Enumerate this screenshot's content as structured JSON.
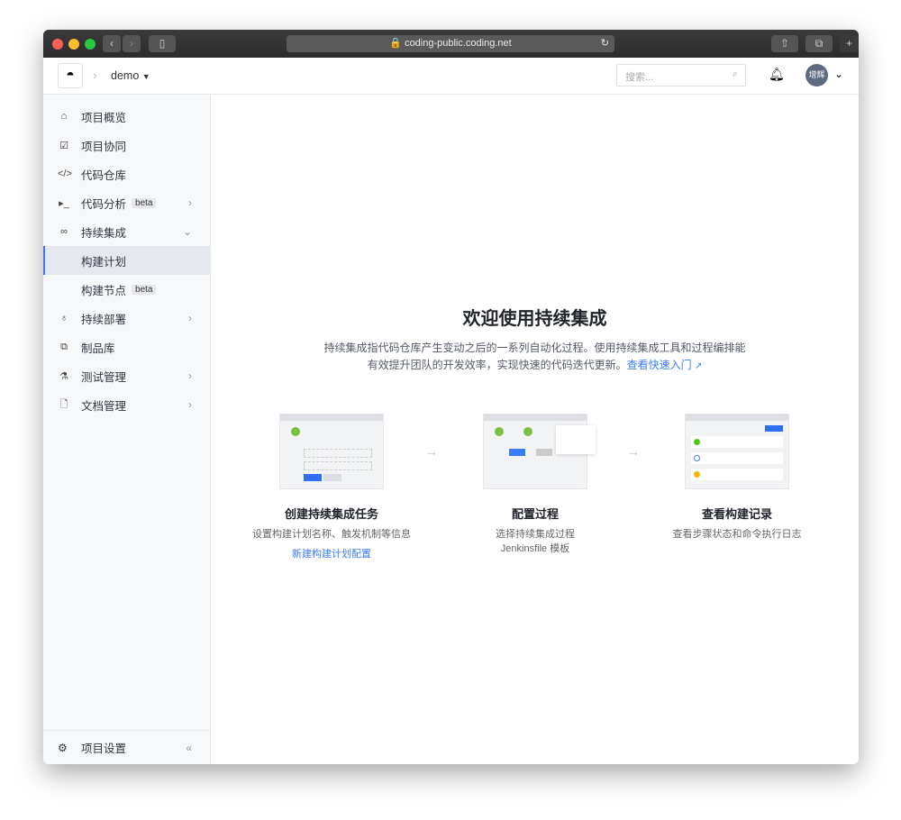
{
  "browser": {
    "url": "coding-public.coding.net"
  },
  "header": {
    "project": "demo",
    "search_placeholder": "搜索...",
    "avatar": "增辉"
  },
  "sidebar": {
    "items": [
      {
        "label": "项目概览"
      },
      {
        "label": "项目协同"
      },
      {
        "label": "代码仓库"
      },
      {
        "label": "代码分析",
        "badge": "beta"
      },
      {
        "label": "持续集成"
      },
      {
        "label": "构建计划"
      },
      {
        "label": "构建节点",
        "badge": "beta"
      },
      {
        "label": "持续部署"
      },
      {
        "label": "制品库"
      },
      {
        "label": "测试管理"
      },
      {
        "label": "文档管理"
      }
    ],
    "settings": "项目设置"
  },
  "main": {
    "title": "欢迎使用持续集成",
    "desc": "持续集成指代码仓库产生变动之后的一系列自动化过程。使用持续集成工具和过程编排能有效提升团队的开发效率，实现快速的代码迭代更新。",
    "link": "查看快速入门",
    "steps": [
      {
        "title": "创建持续集成任务",
        "desc": "设置构建计划名称、触发机制等信息",
        "link": "新建构建计划配置"
      },
      {
        "title": "配置过程",
        "desc": "选择持续集成过程 Jenkinsfile 模板"
      },
      {
        "title": "查看构建记录",
        "desc": "查看步骤状态和命令执行日志"
      }
    ]
  }
}
